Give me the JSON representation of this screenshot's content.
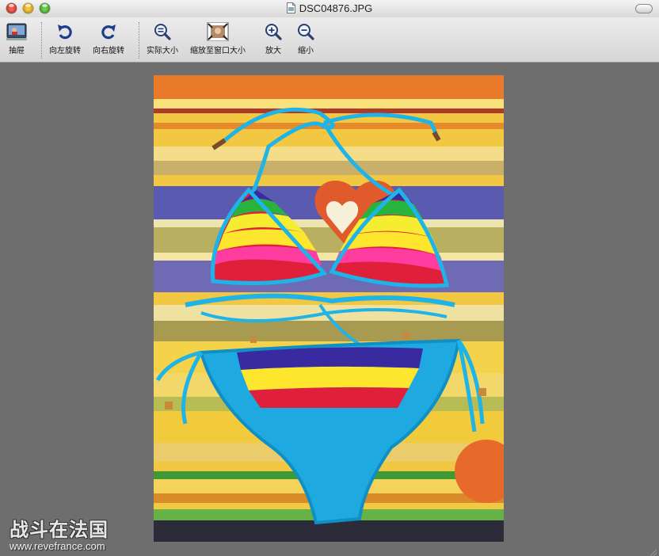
{
  "window": {
    "title": "DSC04876.JPG"
  },
  "toolbar": {
    "drawer": "抽屉",
    "rotate_left": "向左旋转",
    "rotate_right": "向右旋转",
    "actual_size": "实际大小",
    "zoom_to_fit": "缩放至窗口大小",
    "zoom_in": "放大",
    "zoom_out": "缩小"
  },
  "watermark": {
    "logo_text": "战斗在法国",
    "url": "www.revefrance.com"
  },
  "colors": {
    "accent_blue": "#2e6bd8",
    "canvas_gray": "#6e6e6e",
    "bikini_blue": "#1fb4e8"
  }
}
